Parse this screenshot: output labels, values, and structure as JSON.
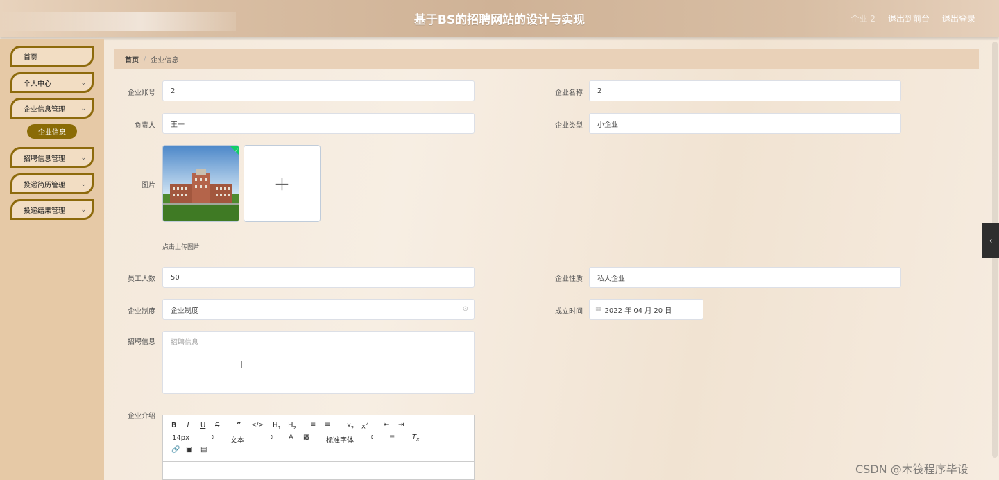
{
  "header": {
    "title": "基于BS的招聘网站的设计与实现",
    "user": "企业 2",
    "back_front": "退出到前台",
    "logout": "退出登录"
  },
  "sidebar": {
    "items": [
      {
        "label": "首页"
      },
      {
        "label": "个人中心"
      },
      {
        "label": "企业信息管理"
      },
      {
        "label": "招聘信息管理"
      },
      {
        "label": "投递简历管理"
      },
      {
        "label": "投递结果管理"
      }
    ],
    "sub_active": "企业信息"
  },
  "breadcrumb": {
    "home": "首页",
    "separator": "/",
    "current": "企业信息"
  },
  "form": {
    "account": {
      "label": "企业账号",
      "value": "2"
    },
    "name": {
      "label": "企业名称",
      "value": "2"
    },
    "owner": {
      "label": "负责人",
      "value": "王一"
    },
    "type": {
      "label": "企业类型",
      "value": "小企业"
    },
    "image": {
      "label": "图片",
      "tip": "点击上传图片",
      "add": "+"
    },
    "staff": {
      "label": "员工人数",
      "value": "50"
    },
    "nature": {
      "label": "企业性质",
      "value": "私人企业"
    },
    "system": {
      "label": "企业制度",
      "value": "企业制度"
    },
    "founded": {
      "label": "成立时间",
      "value": "2022 年 04 月 20 日"
    },
    "recruit": {
      "label": "招聘信息",
      "placeholder": "招聘信息"
    },
    "intro": {
      "label": "企业介绍"
    }
  },
  "editor": {
    "font_size": "14px",
    "paragraph": "文本",
    "font_family": "标准字体"
  },
  "watermark": "CSDN @木筏程序毕设",
  "colors": {
    "accent": "#8a6b06",
    "sidebar_bg": "#e6c9a6",
    "header_bg": "#d4b89c"
  }
}
